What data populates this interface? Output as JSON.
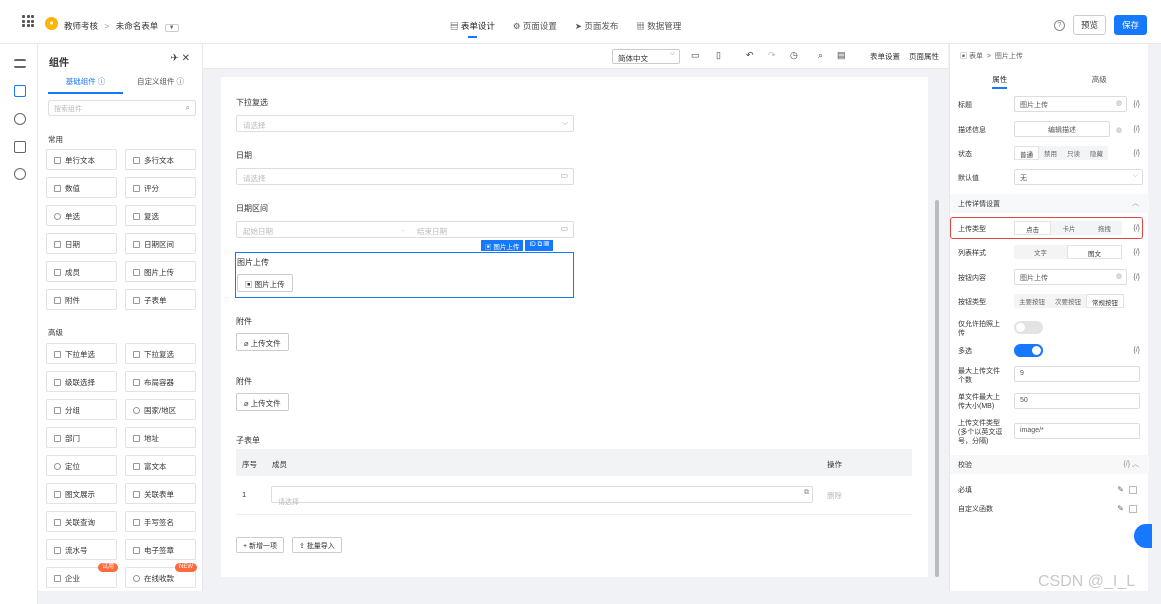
{
  "topbar": {
    "app_name": "教师考核",
    "form_name": "未命名表单",
    "tabs": [
      "表单设计",
      "页面设置",
      "页面发布",
      "数据管理"
    ],
    "active_tab": "表单设计",
    "preview_label": "预览",
    "save_label": "保存",
    "help": "?"
  },
  "components": {
    "title": "组件",
    "tabs": [
      "基础组件 ⓘ",
      "自定义组件 ⓘ"
    ],
    "search_placeholder": "搜索组件",
    "section_common": "常用",
    "common": [
      "单行文本",
      "多行文本",
      "数值",
      "评分",
      "单选",
      "复选",
      "日期",
      "日期区间",
      "成员",
      "图片上传",
      "附件",
      "子表单"
    ],
    "section_advanced": "高级",
    "advanced": [
      "下拉单选",
      "下拉复选",
      "级联选择",
      "布局容器",
      "分组",
      "国家/地区",
      "部门",
      "地址",
      "定位",
      "富文本",
      "图文展示",
      "关联表单",
      "关联查询",
      "手写签名",
      "流水号",
      "电子签章",
      "企业",
      "在线收款"
    ],
    "badge_trial": "试用",
    "badge_new": "NEW"
  },
  "canvas_toolbar": {
    "language": "简体中文",
    "form_settings": "表单设置",
    "page_properties": "页面属性"
  },
  "form": {
    "dropdown_multi_label": "下拉复选",
    "dropdown_multi_placeholder": "请选择",
    "date_label": "日期",
    "date_placeholder": "请选择",
    "daterange_label": "日期区间",
    "daterange_start": "起始日期",
    "daterange_sep": "-",
    "daterange_end": "结束日期",
    "image_upload_label": "图片上传",
    "image_upload_button": "图片上传",
    "selected_tag": "图片上传",
    "selected_id": "ID",
    "attachment1_label": "附件",
    "attachment1_button": "上传文件",
    "attachment2_label": "附件",
    "attachment2_button": "上传文件",
    "subform_label": "子表单",
    "subform_headers": [
      "序号",
      "成员",
      "操作"
    ],
    "subform_row_index": "1",
    "subform_row_placeholder": "请选择",
    "subform_row_delete": "删除",
    "add_item": "+ 新增一项",
    "batch_import": "批量导入"
  },
  "props": {
    "breadcrumb": [
      "表单",
      "图片上传"
    ],
    "tabs": [
      "属性",
      "高级"
    ],
    "title_label": "标题",
    "title_value": "图片上传",
    "desc_label": "描述信息",
    "desc_button": "编辑描述",
    "status_label": "状态",
    "status_options": [
      "普通",
      "禁用",
      "只读",
      "隐藏"
    ],
    "default_label": "默认值",
    "default_value": "无",
    "upload_section": "上传详情设置",
    "upload_type_label": "上传类型",
    "upload_type_options": [
      "点击",
      "卡片",
      "拖拽"
    ],
    "list_style_label": "列表样式",
    "list_style_options": [
      "文字",
      "图文"
    ],
    "button_content_label": "按钮内容",
    "button_content_value": "图片上传",
    "button_type_label": "按钮类型",
    "button_type_options": [
      "主要按钮",
      "次要按钮",
      "常规按钮"
    ],
    "camera_only_label": "仅允许拍照上传",
    "camera_only": false,
    "multiple_label": "多选",
    "multiple": true,
    "max_files_label": "最大上传文件个数",
    "max_files_value": "9",
    "max_size_label": "单文件最大上传大小(MB)",
    "max_size_value": "50",
    "file_types_label": "上传文件类型(多个以英文逗号，分隔)",
    "file_types_value": "image/*",
    "validation_section": "校验",
    "required_label": "必填",
    "custom_func_label": "自定义函数",
    "fx": "{/}"
  },
  "watermark": "CSDN @_I_L",
  "colors": {
    "accent": "#1677ff",
    "highlight": "#e0443e"
  }
}
